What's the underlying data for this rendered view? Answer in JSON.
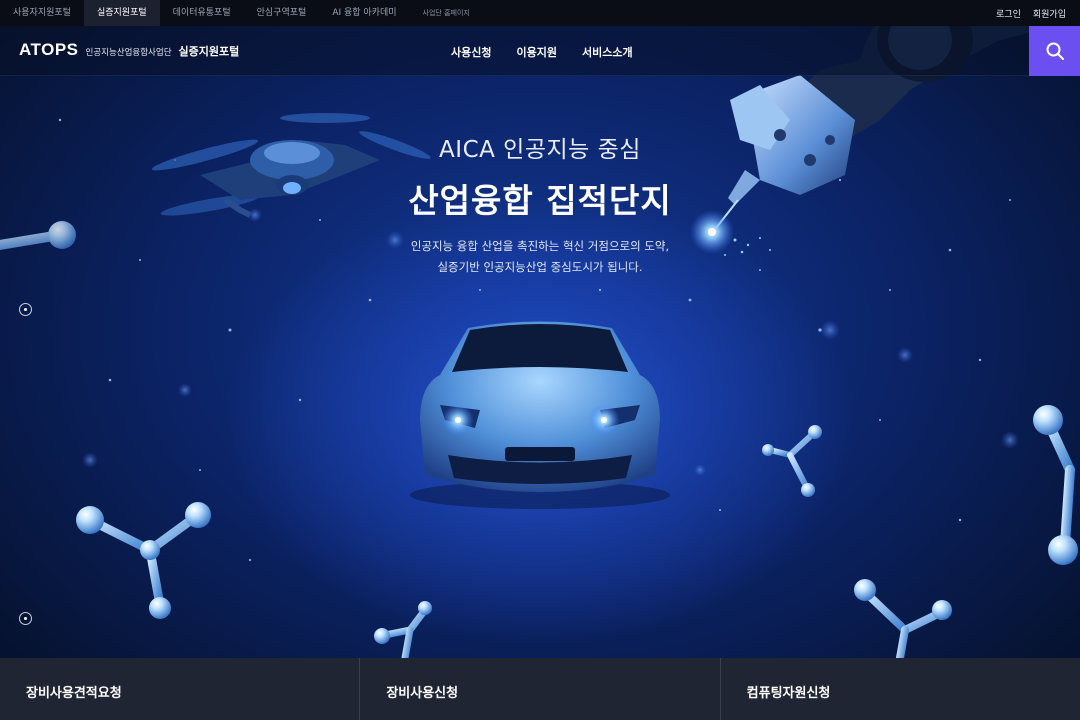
{
  "topbar": {
    "portals": [
      {
        "label": "사용자지원포털",
        "active": false
      },
      {
        "label": "실증지원포털",
        "active": true
      },
      {
        "label": "데이터유통포털",
        "active": false
      },
      {
        "label": "안심구역포털",
        "active": false
      },
      {
        "label": "AI 융합 아카데미",
        "active": false
      },
      {
        "label": "사업단 홈페이지",
        "active": false
      }
    ],
    "login": "로그인",
    "signup": "회원가입"
  },
  "header": {
    "logo": "ATOPS",
    "org": "인공지능산업융합사업단",
    "portal_name": "실증지원포털",
    "nav": [
      "사용신청",
      "이용지원",
      "서비스소개"
    ],
    "search_icon": "search-icon"
  },
  "hero": {
    "eyebrow": "AICA 인공지능 중심",
    "title": "산업융합 집적단지",
    "desc_line1": "인공지능 융합 산업을 촉진하는 혁신 거점으로의 도약,",
    "desc_line2": "실증기반 인공지능산업 중심도시가 됩니다."
  },
  "quick_menu": [
    "장비사용견적요청",
    "장비사용신청",
    "컴퓨팅자원신청"
  ],
  "colors": {
    "accent": "#6b4ff0",
    "hero_blue": "#143a9a",
    "quickbar_bg": "#1f2533"
  }
}
